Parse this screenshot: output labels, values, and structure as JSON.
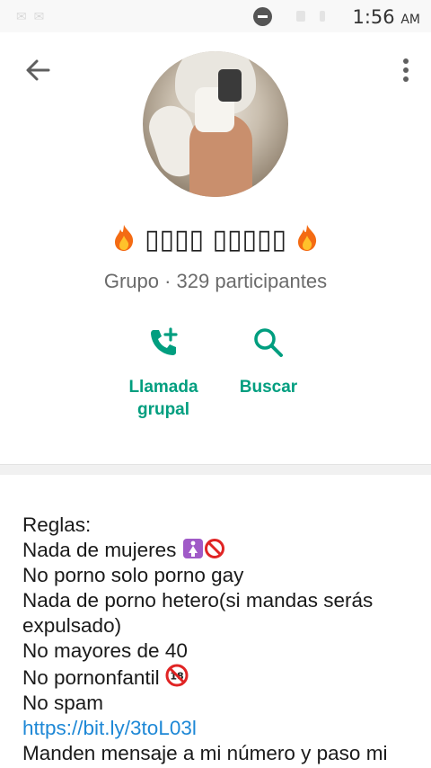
{
  "status_bar": {
    "time": "1:56",
    "ampm": "AM"
  },
  "group": {
    "name": "🔥 ▯▯▯▯ ▯▯▯▯▯ 🔥",
    "name_text": "▯▯▯▯ ▯▯▯▯▯",
    "subtitle": "Grupo · 329 participantes"
  },
  "actions": {
    "call_label_1": "Llamada",
    "call_label_2": "grupal",
    "search_label": "Buscar"
  },
  "description": {
    "lines": [
      "Reglas:",
      "Nada de mujeres",
      "No porno solo porno gay",
      "Nada de porno hetero(si mandas serás expulsado)",
      "No mayores de 40",
      "No pornonfantil",
      "No spam",
      "https://bit.ly/3toL03l",
      "Manden mensaje a mi número y paso mi"
    ]
  },
  "colors": {
    "accent": "#009e7f",
    "link": "#1e88d6"
  }
}
